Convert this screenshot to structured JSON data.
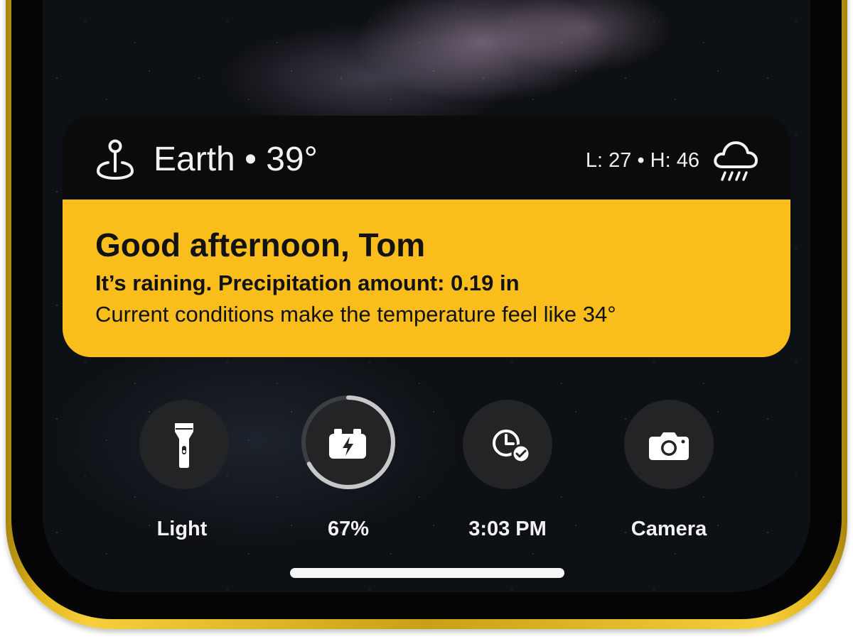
{
  "weather_widget": {
    "location": "Earth",
    "separator": "•",
    "temperature": "39°",
    "low_label": "L: 27",
    "high_label": "H: 46",
    "greeting": "Good afternoon, Tom",
    "condition": "It’s raining. Precipitation amount: 0.19 in",
    "feels_like": "Current conditions make the temperature feel like 34°",
    "icons": {
      "location": "location-pin-icon",
      "weather": "cloud-rain-icon"
    },
    "accent_color": "#f9bd1c"
  },
  "controls": [
    {
      "label": "Light",
      "icon": "flashlight-icon"
    },
    {
      "label": "67%",
      "icon": "battery-charging-icon",
      "battery_level": 0.67
    },
    {
      "label": "3:03 PM",
      "icon": "clock-check-icon"
    },
    {
      "label": "Camera",
      "icon": "camera-icon"
    }
  ]
}
